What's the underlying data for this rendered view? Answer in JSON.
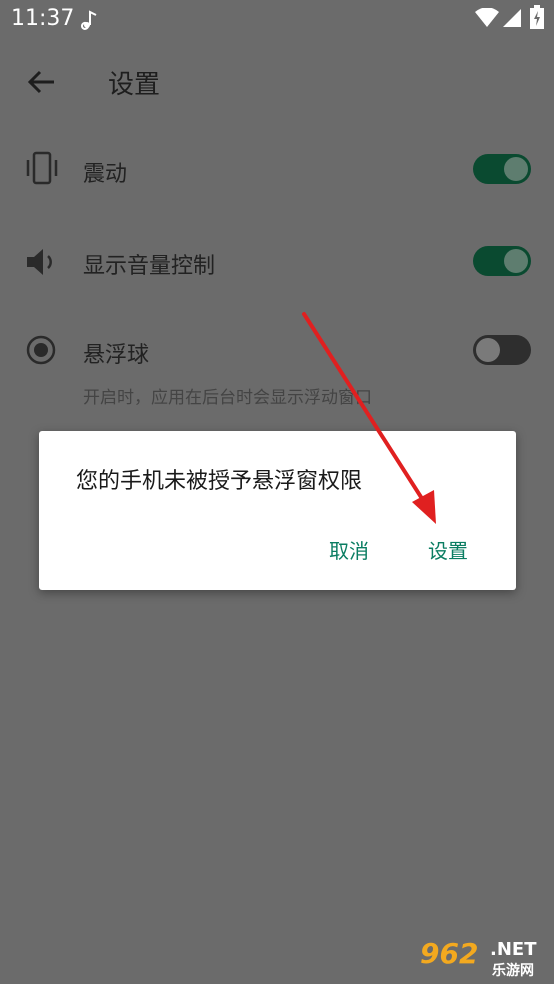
{
  "status_bar": {
    "time": "11:37",
    "icons": [
      "music-note-icon",
      "wifi-icon",
      "signal-icon",
      "battery-charging-icon"
    ]
  },
  "toolbar": {
    "title": "设置",
    "back_icon": "arrow-back-icon"
  },
  "settings": {
    "vibrate": {
      "label": "震动",
      "icon": "phone-vibrate-icon",
      "enabled": true
    },
    "volume": {
      "label": "显示音量控制",
      "icon": "speaker-icon",
      "enabled": true
    },
    "float_ball": {
      "label": "悬浮球",
      "icon": "radio-button-icon",
      "description": "开启时，应用在后台时会显示浮动窗口",
      "enabled": false
    }
  },
  "dialog": {
    "message": "您的手机未被授予悬浮窗权限",
    "cancel_label": "取消",
    "confirm_label": "设置"
  },
  "watermark": {
    "number": "962",
    "domain": ".NET",
    "text": "乐游网"
  },
  "colors": {
    "accent": "#0a7d62",
    "toggle_on": "#0a4a30",
    "overlay_bg": "#6b6b6b",
    "arrow": "#e02020"
  }
}
